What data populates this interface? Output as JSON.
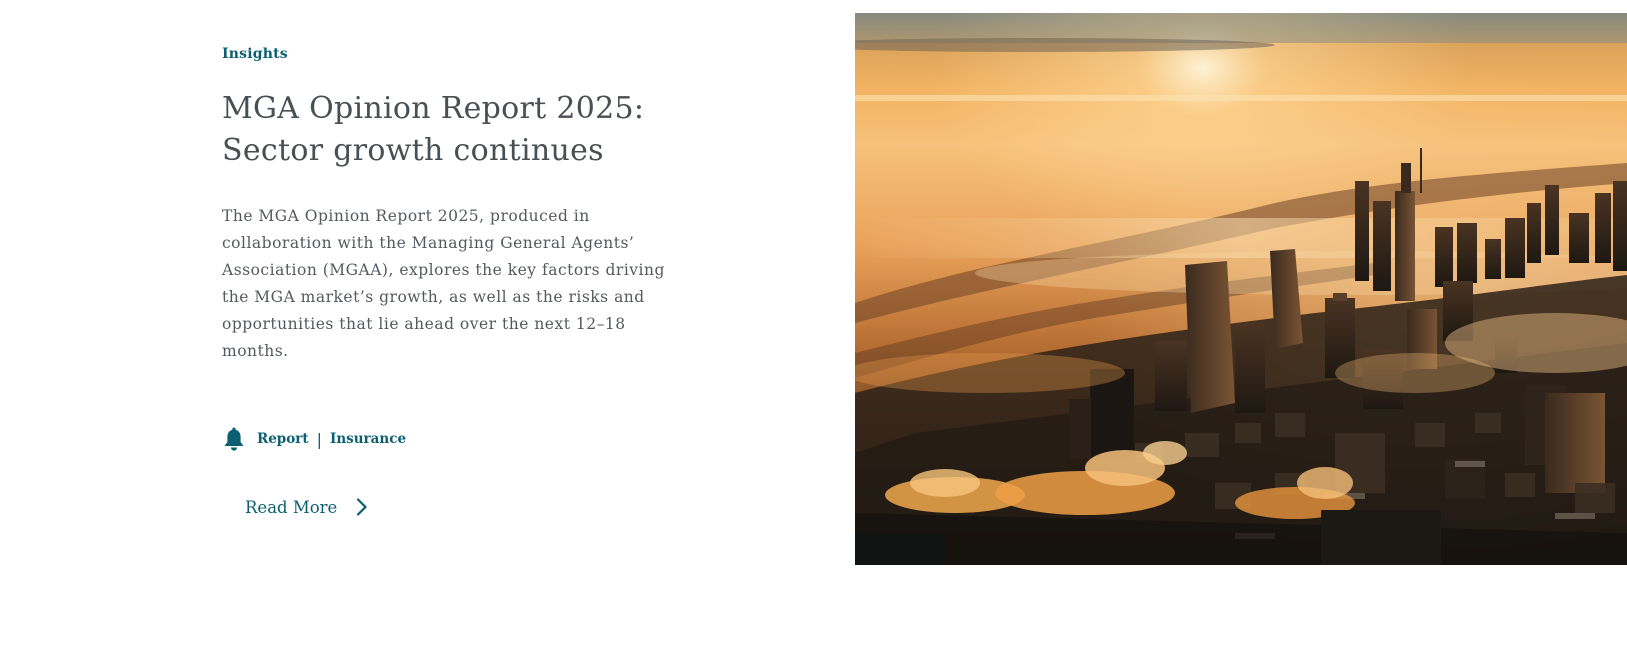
{
  "article": {
    "category": "Insights",
    "title": "MGA Opinion Report 2025: Sector growth continues",
    "description": "The MGA Opinion Report 2025, produced in collaboration with the Managing General Agents’ Association (MGAA), explores the key factors driving the MGA market’s growth, as well as the risks and opportunities that lie ahead over the next 12–18 months.",
    "tags": [
      "Report",
      "Insurance"
    ],
    "tag_separator": "|",
    "read_more_label": "Read More"
  },
  "icons": {
    "tag_icon": "bell-icon",
    "read_more_icon": "chevron-right-icon"
  },
  "colors": {
    "accent": "#0b5f70",
    "title": "#4a4f54",
    "body_text": "#55595e"
  }
}
